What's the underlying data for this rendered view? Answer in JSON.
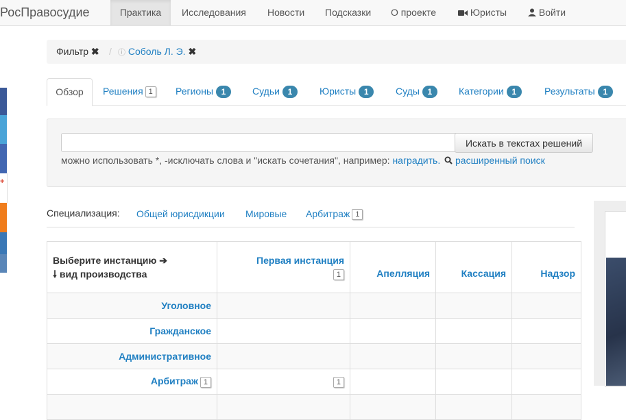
{
  "navbar": {
    "brand": "РосПравосудие",
    "items": [
      "Практика",
      "Исследования",
      "Новости",
      "Подсказки",
      "О проекте"
    ],
    "lawyers": "Юристы",
    "login": "Войти"
  },
  "filter": {
    "label": "Фильтр",
    "separator": "/",
    "value": "Соболь Л. Э."
  },
  "tabs": [
    {
      "label": "Обзор"
    },
    {
      "label": "Решения",
      "count": "1"
    },
    {
      "label": "Регионы",
      "count": "1"
    },
    {
      "label": "Судьи",
      "count": "1"
    },
    {
      "label": "Юристы",
      "count": "1"
    },
    {
      "label": "Суды",
      "count": "1"
    },
    {
      "label": "Категории",
      "count": "1"
    },
    {
      "label": "Результаты",
      "count": "1"
    }
  ],
  "search": {
    "placeholder": "",
    "button": "Искать в текстах решений",
    "hint": "можно использовать *, -исключать слова и \"искать сочетания\", например:",
    "example": "наградить.",
    "advanced": "расширенный поиск"
  },
  "specialization": {
    "label": "Специализация:",
    "items": [
      "Общей юрисдикции",
      "Мировые",
      "Арбитраж"
    ],
    "arbitrage_count": "1"
  },
  "table": {
    "corner_line1": "Выберите инстанцию",
    "corner_line2": "вид производства",
    "columns": [
      "Первая инстанция",
      "Апелляция",
      "Кассация",
      "Надзор"
    ],
    "first_instance_count": "1",
    "rows": [
      "Уголовное",
      "Гражданское",
      "Административное",
      "Арбитраж"
    ],
    "arbitrage_count": "1",
    "arbitrage_first_count": "1"
  },
  "colors": {
    "link": "#1f7fc2",
    "badge": "#3a87ad"
  }
}
